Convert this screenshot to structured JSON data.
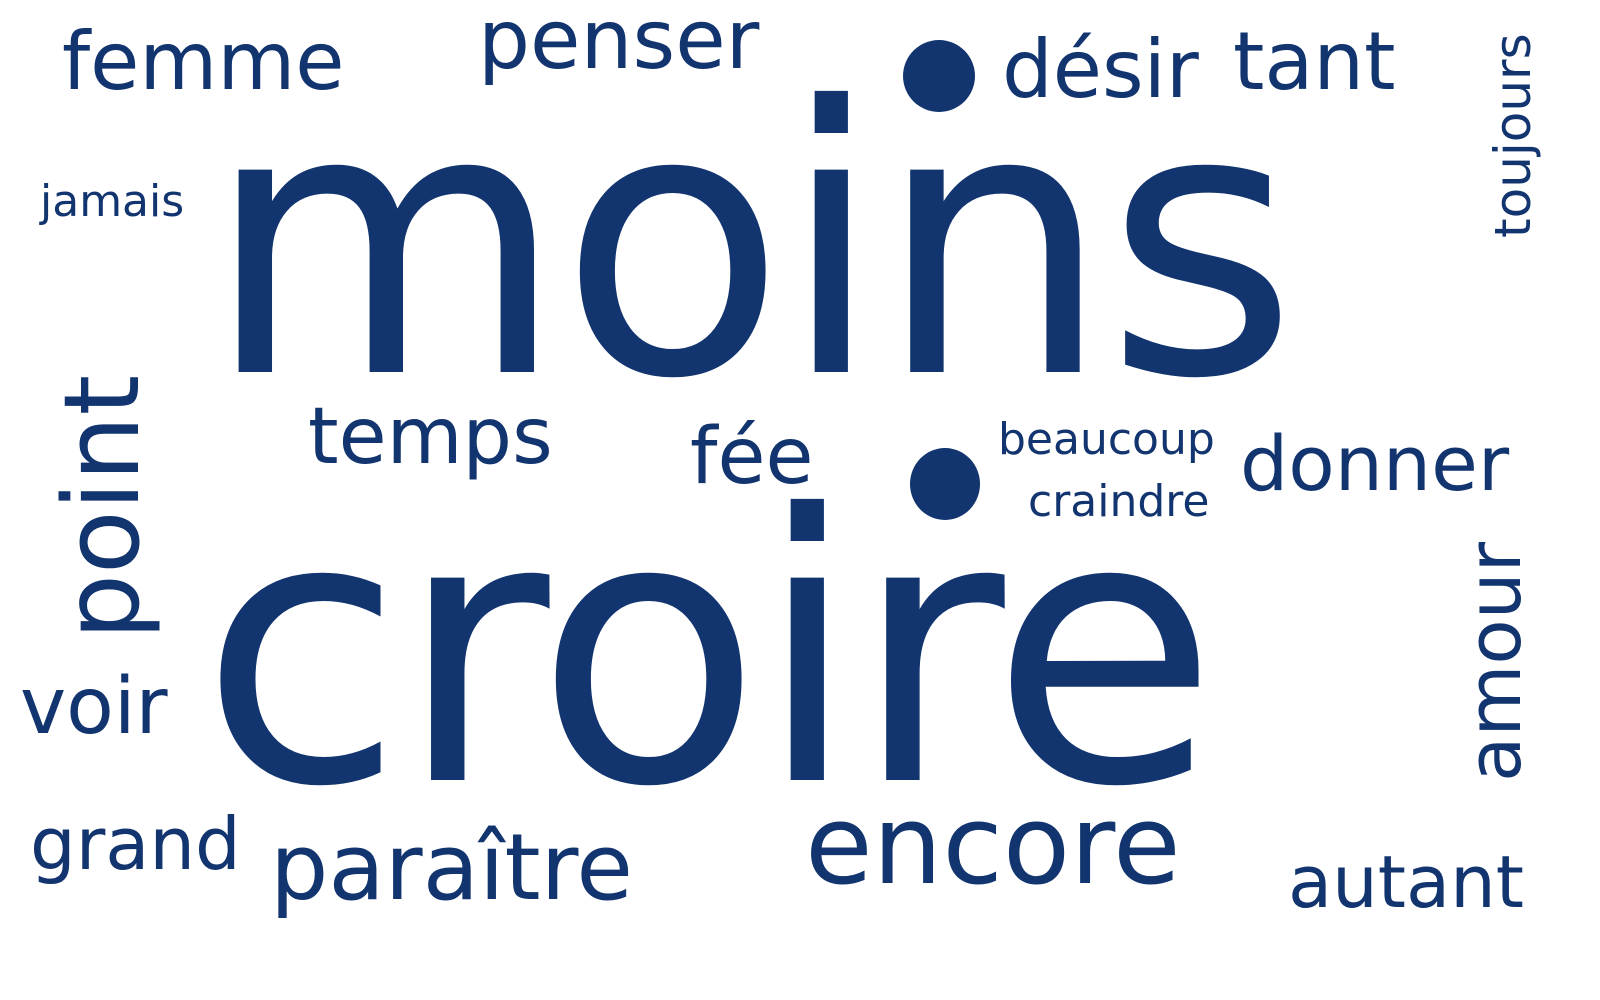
{
  "accent_color": "#12346f",
  "background_color": "#ffffff",
  "words": [
    {
      "text": "moins"
    },
    {
      "text": "croire"
    },
    {
      "text": "encore"
    },
    {
      "text": "paraître"
    },
    {
      "text": "point"
    },
    {
      "text": "penser"
    },
    {
      "text": "femme"
    },
    {
      "text": "désir"
    },
    {
      "text": "tant"
    },
    {
      "text": "temps"
    },
    {
      "text": "fée"
    },
    {
      "text": "donner"
    },
    {
      "text": "amour"
    },
    {
      "text": "voir"
    },
    {
      "text": "grand"
    },
    {
      "text": "autant"
    },
    {
      "text": "toujours"
    },
    {
      "text": "beaucoup"
    },
    {
      "text": "craindre"
    },
    {
      "text": "jamais"
    }
  ],
  "shapes": [
    {
      "name": "dot-top"
    },
    {
      "name": "dot-middle"
    }
  ]
}
